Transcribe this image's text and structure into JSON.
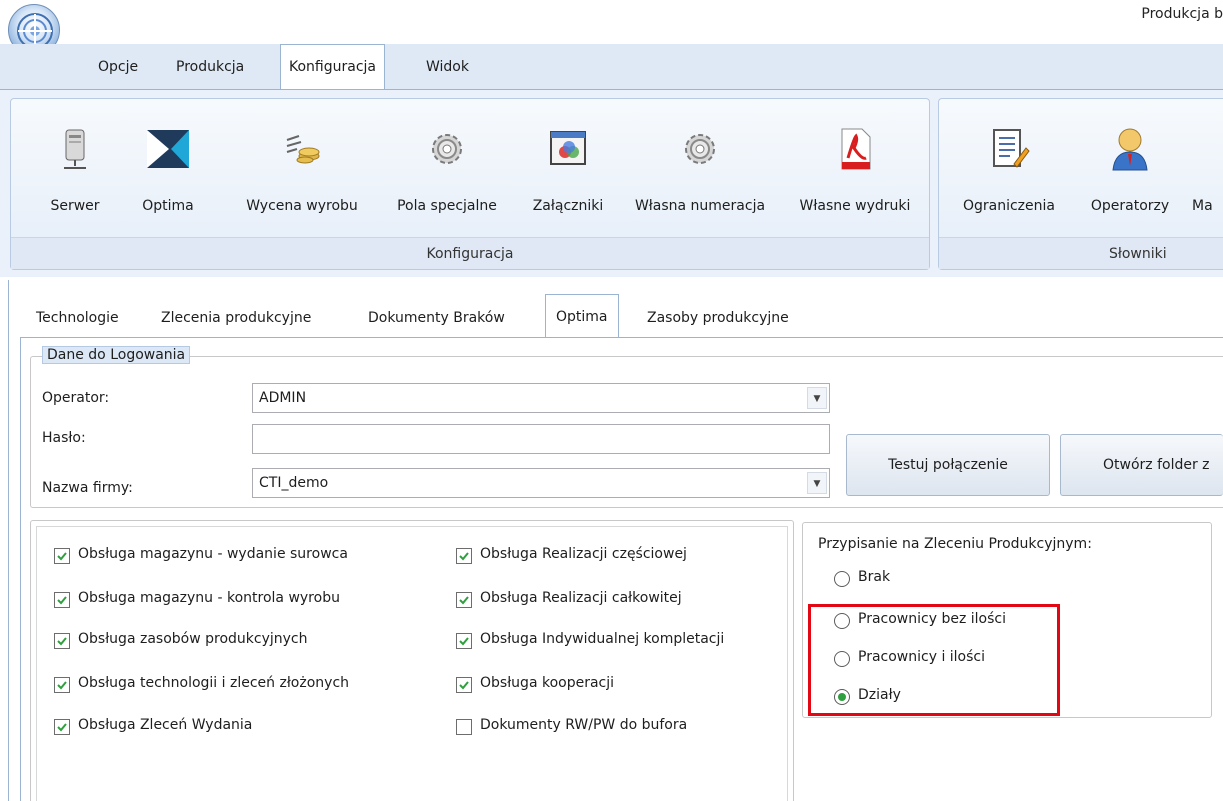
{
  "window": {
    "title": "Produkcja b"
  },
  "colors": {
    "accent": "#9bb4d2",
    "highlight": "#e30613",
    "check": "#2f9f3f"
  },
  "ribbon_tabs": [
    {
      "label": "Opcje"
    },
    {
      "label": "Produkcja"
    },
    {
      "label": "Konfiguracja",
      "active": true
    },
    {
      "label": "Widok"
    }
  ],
  "ribbon": {
    "groups": [
      {
        "label": "Konfiguracja"
      },
      {
        "label": "Słowniki"
      }
    ],
    "buttons": [
      {
        "label": "Serwer",
        "icon": "server-icon"
      },
      {
        "label": "Optima",
        "icon": "optima-logo-icon"
      },
      {
        "label": "Wycena wyrobu",
        "icon": "pricing-icon"
      },
      {
        "label": "Pola specjalne",
        "icon": "gear-icon"
      },
      {
        "label": "Załączniki",
        "icon": "attachment-icon"
      },
      {
        "label": "Własna numeracja",
        "icon": "gear-icon"
      },
      {
        "label": "Własne wydruki",
        "icon": "pdf-icon"
      },
      {
        "label": "Ograniczenia",
        "icon": "document-edit-icon"
      },
      {
        "label": "Operatorzy",
        "icon": "user-icon"
      },
      {
        "label": "Ma",
        "icon": ""
      }
    ]
  },
  "sub_tabs": [
    {
      "label": "Technologie"
    },
    {
      "label": "Zlecenia produkcyjne"
    },
    {
      "label": "Dokumenty Braków"
    },
    {
      "label": "Optima",
      "active": true
    },
    {
      "label": "Zasoby produkcyjne"
    }
  ],
  "login": {
    "legend": "Dane do Logowania",
    "operator_label": "Operator:",
    "operator_value": "ADMIN",
    "password_label": "Hasło:",
    "password_value": "",
    "company_label": "Nazwa firmy:",
    "company_value": "CTI_demo",
    "test_button": "Testuj połączenie",
    "open_folder_button": "Otwórz folder z"
  },
  "options": {
    "left": [
      {
        "label": "Obsługa magazynu - wydanie surowca",
        "checked": true
      },
      {
        "label": "Obsługa magazynu - kontrola wyrobu",
        "checked": true
      },
      {
        "label": "Obsługa zasobów produkcyjnych",
        "checked": true
      },
      {
        "label": "Obsługa technologii i zleceń złożonych",
        "checked": true
      },
      {
        "label": "Obsługa Zleceń Wydania",
        "checked": true
      }
    ],
    "right": [
      {
        "label": "Obsługa Realizacji częściowej",
        "checked": true
      },
      {
        "label": "Obsługa Realizacji całkowitej",
        "checked": true
      },
      {
        "label": "Obsługa Indywidualnej kompletacji",
        "checked": true
      },
      {
        "label": "Obsługa kooperacji",
        "checked": true
      },
      {
        "label": "Dokumenty RW/PW do bufora",
        "checked": false
      }
    ]
  },
  "assignment": {
    "title": "Przypisanie na Zleceniu Produkcyjnym:",
    "options": [
      {
        "label": "Brak",
        "selected": false
      },
      {
        "label": "Pracownicy bez ilości",
        "selected": false
      },
      {
        "label": "Pracownicy i ilości",
        "selected": false
      },
      {
        "label": "Działy",
        "selected": true
      }
    ]
  }
}
